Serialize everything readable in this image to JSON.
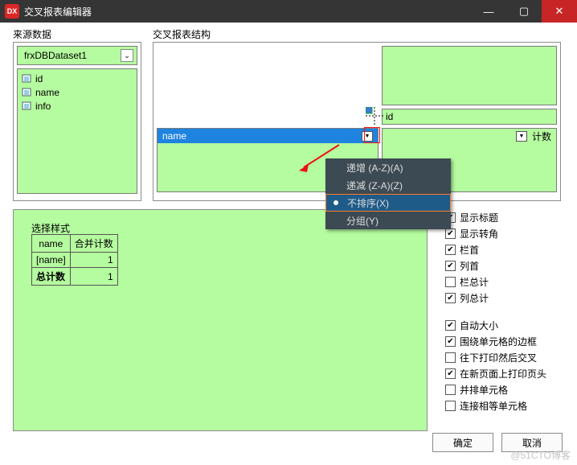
{
  "title": "交叉报表编辑器",
  "logo": "DX",
  "labels": {
    "datasource": "来源数据",
    "structure": "交叉报表结构",
    "selectStyle": "选择样式"
  },
  "dataset": {
    "name": "frxDBDataset1",
    "fields": [
      "id",
      "name",
      "info"
    ]
  },
  "struct": {
    "row_field": "name",
    "col_field": "id",
    "agg": "计数"
  },
  "menu": {
    "items": [
      "递增 (A-Z)(A)",
      "递减 (Z-A)(Z)",
      "不排序(X)",
      "分组(Y)"
    ],
    "selectedIndex": 2
  },
  "previewTable": {
    "headers": [
      "name",
      "合并计数"
    ],
    "rows": [
      [
        "[name]",
        "1"
      ],
      [
        "总计数",
        "1"
      ]
    ]
  },
  "options": [
    {
      "label": "显示标题",
      "checked": true
    },
    {
      "label": "显示转角",
      "checked": true
    },
    {
      "label": "栏首",
      "checked": true
    },
    {
      "label": "列首",
      "checked": true
    },
    {
      "label": "栏总计",
      "checked": false
    },
    {
      "label": "列总计",
      "checked": true
    },
    {
      "label": "自动大小",
      "checked": true,
      "gapBefore": true
    },
    {
      "label": "围绕单元格的边框",
      "checked": true
    },
    {
      "label": "往下打印然后交叉",
      "checked": false
    },
    {
      "label": "在新页面上打印页头",
      "checked": true
    },
    {
      "label": "并排单元格",
      "checked": false
    },
    {
      "label": "连接相等单元格",
      "checked": false
    }
  ],
  "buttons": {
    "ok": "确定",
    "cancel": "取消"
  },
  "watermark": "@51CTO博客"
}
